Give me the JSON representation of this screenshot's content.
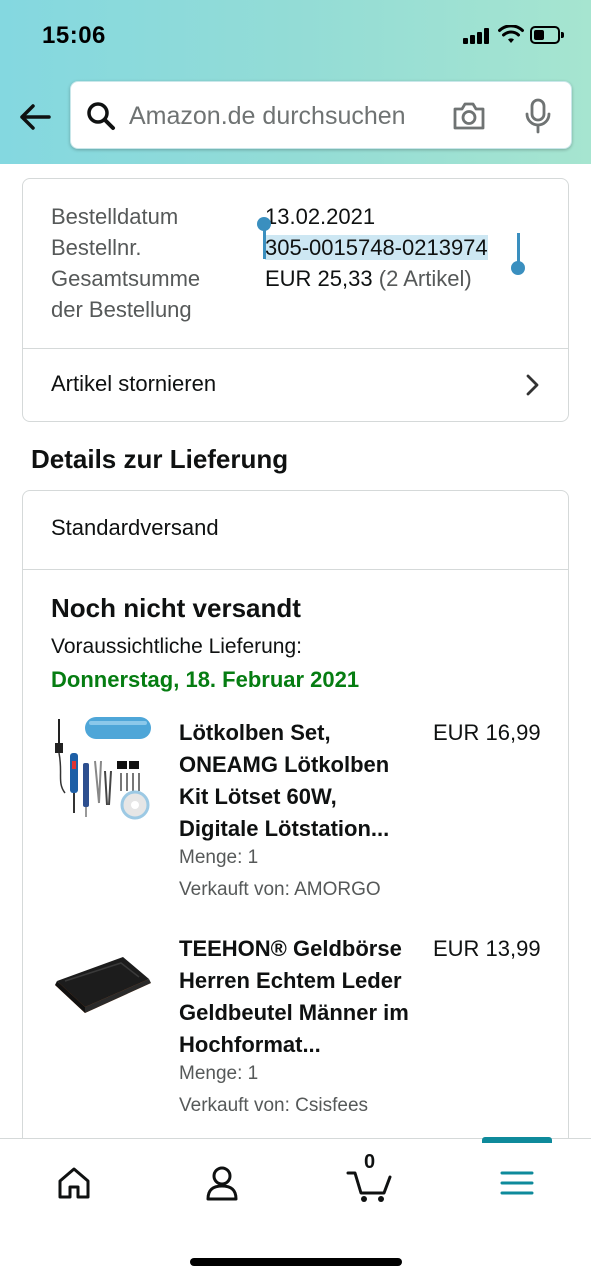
{
  "status_bar": {
    "time": "15:06"
  },
  "search": {
    "placeholder": "Amazon.de durchsuchen"
  },
  "order": {
    "date_label": "Bestelldatum",
    "date_value": "13.02.2021",
    "number_label": "Bestellnr.",
    "number_value": "305-0015748-0213974",
    "total_label_line1": "Gesamtsumme",
    "total_label_line2": "der Bestellung",
    "total_value": "EUR 25,33",
    "total_count": "(2 Artikel)",
    "cancel_label": "Artikel stornieren"
  },
  "delivery": {
    "section_title": "Details zur Lieferung",
    "shipping_method": "Standardversand",
    "status": "Noch nicht versandt",
    "expected_label": "Voraussichtliche Lieferung:",
    "expected_date": "Donnerstag, 18. Februar 2021",
    "items": [
      {
        "title": "Lötkolben Set, ONEAMG Lötkolben Kit Lötset 60W, Digitale Lötstation...",
        "price": "EUR 16,99",
        "quantity": "Menge: 1",
        "seller": "Verkauft von: AMORGO",
        "image_icon": "soldering-kit-image"
      },
      {
        "title": "TEEHON® Geldbörse Herren Echtem Leder Geldbeutel Männer im Hochformat...",
        "price": "EUR 13,99",
        "quantity": "Menge: 1",
        "seller": "Verkauft von: Csisfees",
        "image_icon": "wallet-image"
      }
    ]
  },
  "bottom_nav": {
    "cart_count": "0",
    "items": [
      "home-icon",
      "account-icon",
      "cart-icon",
      "menu-icon"
    ],
    "active": "menu-icon"
  },
  "colors": {
    "accent": "#067d12",
    "selection": "#3a8fbf",
    "nav_active": "#0e8a9b"
  }
}
